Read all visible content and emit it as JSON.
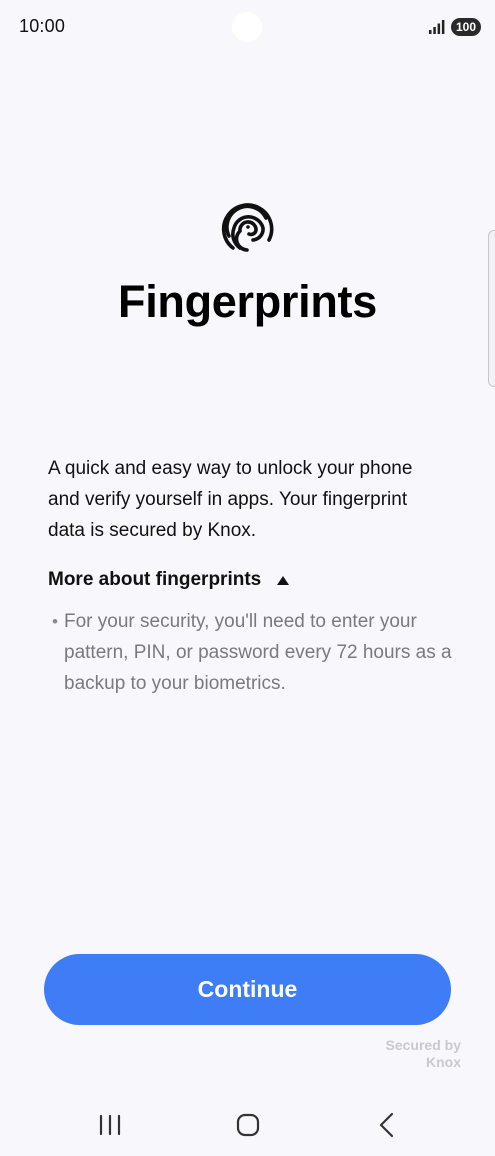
{
  "status_bar": {
    "time": "10:00",
    "battery": "100",
    "icons": [
      "signal-icon",
      "battery-icon"
    ]
  },
  "header": {
    "icon": "fingerprint-icon",
    "title": "Fingerprints"
  },
  "main": {
    "description": "A quick and easy way to unlock your phone and verify yourself in apps. Your fingerprint data is secured by Knox.",
    "more_label": "More about fingerprints",
    "bullet_text": "For your security, you'll need to enter your pattern, PIN, or password every 72 hours as a backup to your biometrics."
  },
  "footer": {
    "continue_label": "Continue",
    "secured_line1": "Secured by",
    "secured_line2": "Knox"
  },
  "nav_bar": {
    "icons": [
      "recents-icon",
      "home-icon",
      "back-icon"
    ]
  },
  "colors": {
    "background": "#f8f8fc",
    "accent": "#3e7df5",
    "primary_text": "#111111",
    "secondary_text": "#7a7a7e"
  }
}
